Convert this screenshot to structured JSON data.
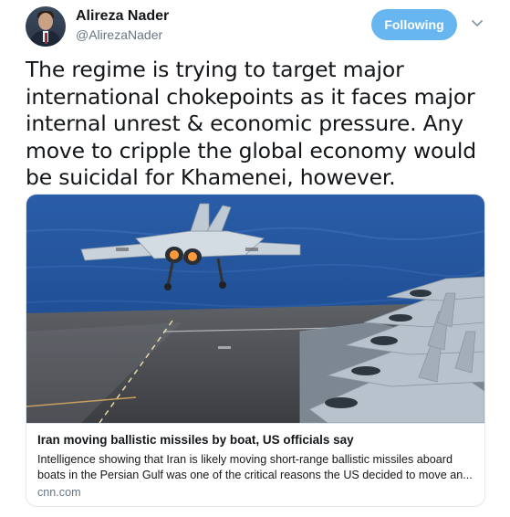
{
  "author": {
    "display_name": "Alireza Nader",
    "handle": "@AlirezaNader"
  },
  "follow_button": {
    "label": "Following"
  },
  "tweet": {
    "text": "The regime is trying to target major international chokepoints as it faces major internal unrest & economic pressure. Any move to cripple the global economy would be suicidal for Khamenei, however."
  },
  "link_card": {
    "title": "Iran moving ballistic missiles by boat, US officials say",
    "description": "Intelligence showing that Iran is likely moving short-range ballistic missiles aboard boats in the Persian Gulf was one of the critical reasons the US decided to move an...",
    "domain": "cnn.com",
    "image_label": "Fighter jet launching from aircraft carrier deck"
  },
  "icons": {
    "menu": "chevron-down-icon",
    "avatar": "avatar"
  },
  "colors": {
    "accent": "#1da1f2",
    "follow_bg": "#67b6ef",
    "text": "#14171a",
    "muted": "#657786"
  }
}
